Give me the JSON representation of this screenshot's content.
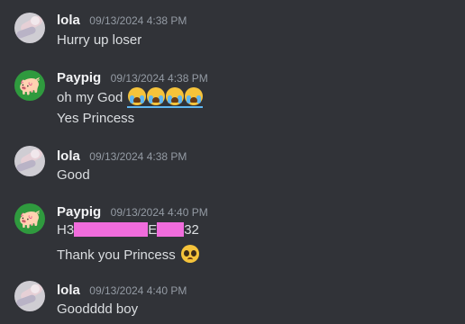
{
  "messages": [
    {
      "author": "lola",
      "timestamp": "09/13/2024 4:38 PM",
      "avatar": "lola-avatar",
      "lines": [
        "Hurry up loser"
      ]
    },
    {
      "author": "Paypig",
      "timestamp": "09/13/2024 4:38 PM",
      "avatar": "pig-emoji-avatar",
      "lines": [
        "oh my God",
        "Yes Princess"
      ]
    },
    {
      "author": "lola",
      "timestamp": "09/13/2024 4:38 PM",
      "avatar": "lola-avatar",
      "lines": [
        "Good"
      ]
    },
    {
      "author": "Paypig",
      "timestamp": "09/13/2024 4:40 PM",
      "avatar": "pig-emoji-avatar",
      "lines": [
        "H3",
        "E",
        "32",
        "Thank you Princess"
      ]
    },
    {
      "author": "lola",
      "timestamp": "09/13/2024 4:40 PM",
      "avatar": "lola-avatar",
      "lines": [
        "Goodddd boy"
      ]
    }
  ],
  "emojis": {
    "loudly_crying": "loudly-crying-face-icon",
    "pleading": "pleading-face-icon"
  },
  "colors": {
    "background": "#313338",
    "username": "#f2f3f5",
    "timestamp": "#949ba4",
    "text": "#dbdee1",
    "redaction": "#f06cdc",
    "pig_avatar_bg": "#2f9a3e"
  }
}
